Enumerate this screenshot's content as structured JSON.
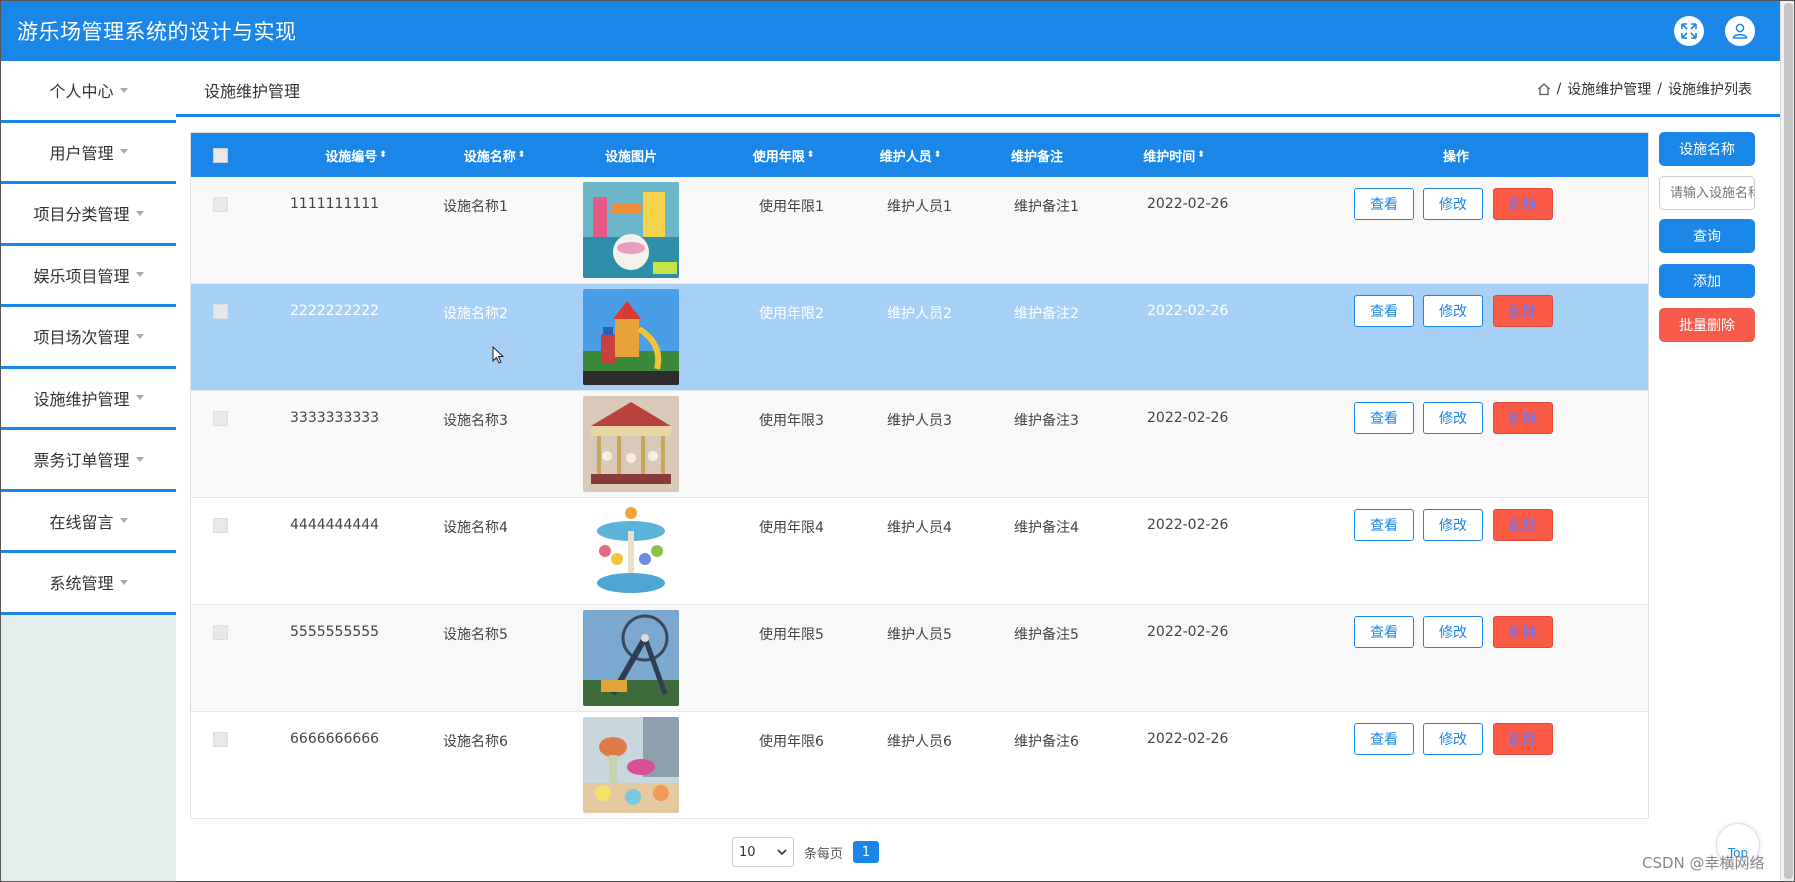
{
  "header": {
    "title": "游乐场管理系统的设计与实现"
  },
  "sidebar": {
    "items": [
      {
        "label": "个人中心"
      },
      {
        "label": "用户管理"
      },
      {
        "label": "项目分类管理"
      },
      {
        "label": "娱乐项目管理"
      },
      {
        "label": "项目场次管理"
      },
      {
        "label": "设施维护管理"
      },
      {
        "label": "票务订单管理"
      },
      {
        "label": "在线留言"
      },
      {
        "label": "系统管理"
      }
    ]
  },
  "page": {
    "title": "设施维护管理",
    "breadcrumb": [
      "设施维护管理",
      "设施维护列表"
    ],
    "breadcrumb_sep": "/"
  },
  "table": {
    "columns": [
      "设施编号",
      "设施名称",
      "设施图片",
      "使用年限",
      "维护人员",
      "维护备注",
      "维护时间",
      "操作"
    ],
    "sort_icon": "⬍",
    "actions": {
      "view": "查看",
      "edit": "修改",
      "delete": "删除"
    },
    "rows": [
      {
        "code": "1111111111",
        "name": "设施名称1",
        "years": "使用年限1",
        "staff": "维护人员1",
        "note": "维护备注1",
        "time": "2022-02-26",
        "image": "indoor-playground-photo"
      },
      {
        "code": "2222222222",
        "name": "设施名称2",
        "years": "使用年限2",
        "staff": "维护人员2",
        "note": "维护备注2",
        "time": "2022-02-26",
        "image": "playground-slide-photo"
      },
      {
        "code": "3333333333",
        "name": "设施名称3",
        "years": "使用年限3",
        "staff": "维护人员3",
        "note": "维护备注3",
        "time": "2022-02-26",
        "image": "carousel-photo"
      },
      {
        "code": "4444444444",
        "name": "设施名称4",
        "years": "使用年限4",
        "staff": "维护人员4",
        "note": "维护备注4",
        "time": "2022-02-26",
        "image": "mini-carousel-photo"
      },
      {
        "code": "5555555555",
        "name": "设施名称5",
        "years": "使用年限5",
        "staff": "维护人员5",
        "note": "维护备注5",
        "time": "2022-02-26",
        "image": "pendulum-ride-photo"
      },
      {
        "code": "6666666666",
        "name": "设施名称6",
        "years": "使用年限6",
        "staff": "维护人员6",
        "note": "维护备注6",
        "time": "2022-02-26",
        "image": "teacup-ride-photo"
      }
    ]
  },
  "right_panel": {
    "field_label": "设施名称",
    "search_placeholder": "请输入设施名称",
    "query": "查询",
    "add": "添加",
    "batch_delete": "批量删除"
  },
  "pagination": {
    "page_size": "10",
    "per_page_label": "条每页",
    "current_page": "1"
  },
  "back_to_top": "Top",
  "watermark": "CSDN @幸横网络",
  "colors": {
    "primary": "#1a86e8",
    "danger": "#fb5a44",
    "row_hover": "#a6d0f5",
    "sidebar_bg": "#e4efec"
  }
}
